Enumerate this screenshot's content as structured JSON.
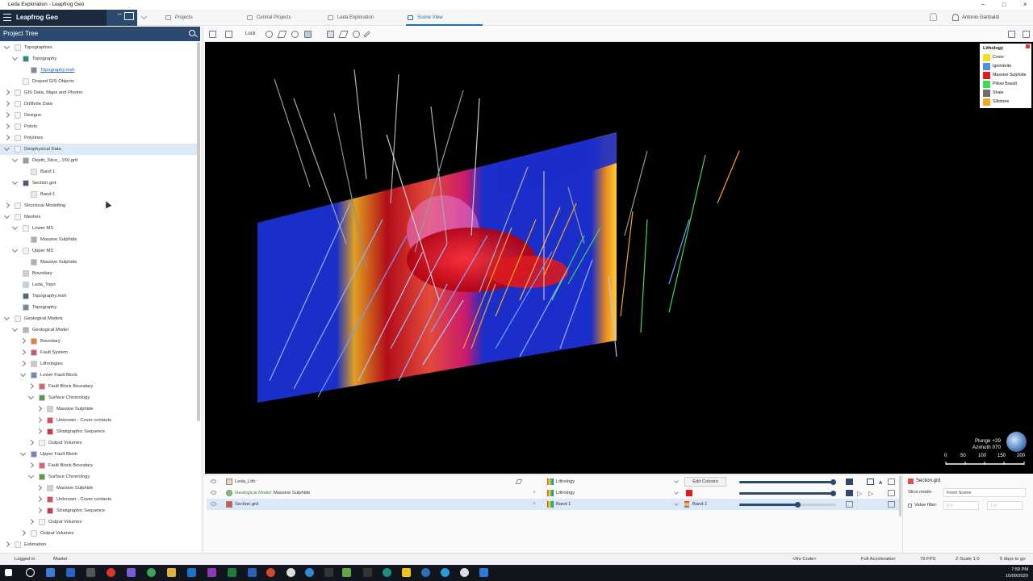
{
  "window": {
    "title": "Leda Exploration - Leapfrog Geo"
  },
  "app": {
    "name": "Leapfrog Geo"
  },
  "tabs": [
    {
      "label": "Projects"
    },
    {
      "label": "Central Projects"
    },
    {
      "label": "Leda Exploration"
    },
    {
      "label": "Scene View"
    }
  ],
  "user": {
    "name": "Antonio Garibaldi"
  },
  "project_tree": {
    "title": "Project Tree",
    "items": [
      {
        "label": "Topographies"
      },
      {
        "label": "Topography"
      },
      {
        "label": "Topography.msh"
      },
      {
        "label": "Draped GIS Objects"
      },
      {
        "label": "GIS Data, Maps and Photos"
      },
      {
        "label": "Drillhole Data"
      },
      {
        "label": "Designs"
      },
      {
        "label": "Points"
      },
      {
        "label": "Polylines"
      },
      {
        "label": "Geophysical Data"
      },
      {
        "label": "Depth_Slice_-150.grd"
      },
      {
        "label": "Band 1"
      },
      {
        "label": "Section.grd"
      },
      {
        "label": "Band 1"
      },
      {
        "label": "Structural Modelling"
      },
      {
        "label": "Meshes"
      },
      {
        "label": "Lower MS"
      },
      {
        "label": "Massive Sulphide"
      },
      {
        "label": "Upper MS"
      },
      {
        "label": "Massive Sulphide"
      },
      {
        "label": "Boundary"
      },
      {
        "label": "Leda_Topo"
      },
      {
        "label": "Topography.msh"
      },
      {
        "label": "Topography"
      },
      {
        "label": "Geological Models"
      },
      {
        "label": "Geological Model"
      },
      {
        "label": "Boundary"
      },
      {
        "label": "Fault System"
      },
      {
        "label": "Lithologies"
      },
      {
        "label": "Lower Fault Block"
      },
      {
        "label": "Fault Block Boundary"
      },
      {
        "label": "Surface Chronology"
      },
      {
        "label": "Massive Sulphide"
      },
      {
        "label": "Unknown - Cover contacts"
      },
      {
        "label": "Stratigraphic Sequence"
      },
      {
        "label": "Output Volumes"
      },
      {
        "label": "Upper Fault Block"
      },
      {
        "label": "Fault Block Boundary"
      },
      {
        "label": "Surface Chronology"
      },
      {
        "label": "Massive Sulphide"
      },
      {
        "label": "Unknown - Cover contacts"
      },
      {
        "label": "Stratigraphic Sequence"
      },
      {
        "label": "Output Volumes"
      },
      {
        "label": "Output Volumes"
      },
      {
        "label": "Estimation"
      }
    ]
  },
  "toolbar": {
    "lock_label": "Lock"
  },
  "legend": {
    "title": "Lithology",
    "items": [
      {
        "name": "Cover",
        "color": "#f5e11b"
      },
      {
        "name": "Ignimbrite",
        "color": "#4f8fe6"
      },
      {
        "name": "Massive Sulphide",
        "color": "#e31a1c"
      },
      {
        "name": "Pillow Basalt",
        "color": "#3ddc54"
      },
      {
        "name": "Shale",
        "color": "#6d6d6d"
      },
      {
        "name": "Siltstone",
        "color": "#f5a623"
      }
    ]
  },
  "scene": {
    "plunge": "Plunge +29",
    "azimuth": "Azimuth 070",
    "scale_labels": [
      "0",
      "50",
      "100",
      "150",
      "200"
    ]
  },
  "layers": [
    {
      "name": "Leda_Lith",
      "prefix": "",
      "colouring": "Lithology",
      "action": "Edit Colours",
      "opacity": 0.97
    },
    {
      "name": "Massive Sulphide",
      "prefix": "Geological Model:",
      "colouring": "Lithology",
      "action": "",
      "opacity": 0.97
    },
    {
      "name": "Section.grd",
      "prefix": "",
      "colouring": "Band 1",
      "action": "Band 1",
      "opacity": 0.6
    }
  ],
  "properties": {
    "title": "Section.grd",
    "slice_mode_label": "Slice mode:",
    "slice_mode_value": "From Scene",
    "value_filter_label": "Value filter:",
    "value_filter_min": "0.0",
    "value_filter_max": "1.0"
  },
  "status": {
    "logged_in": "Logged in",
    "branch": "Master",
    "code": "<No Code>",
    "acceleration": "Full Acceleration",
    "fps": "75 FPS",
    "zscale": "Z-Scale 1.0",
    "days": "5 days to go"
  },
  "taskbar": {
    "time": "7:59 PM",
    "date": "10/09/2020"
  }
}
